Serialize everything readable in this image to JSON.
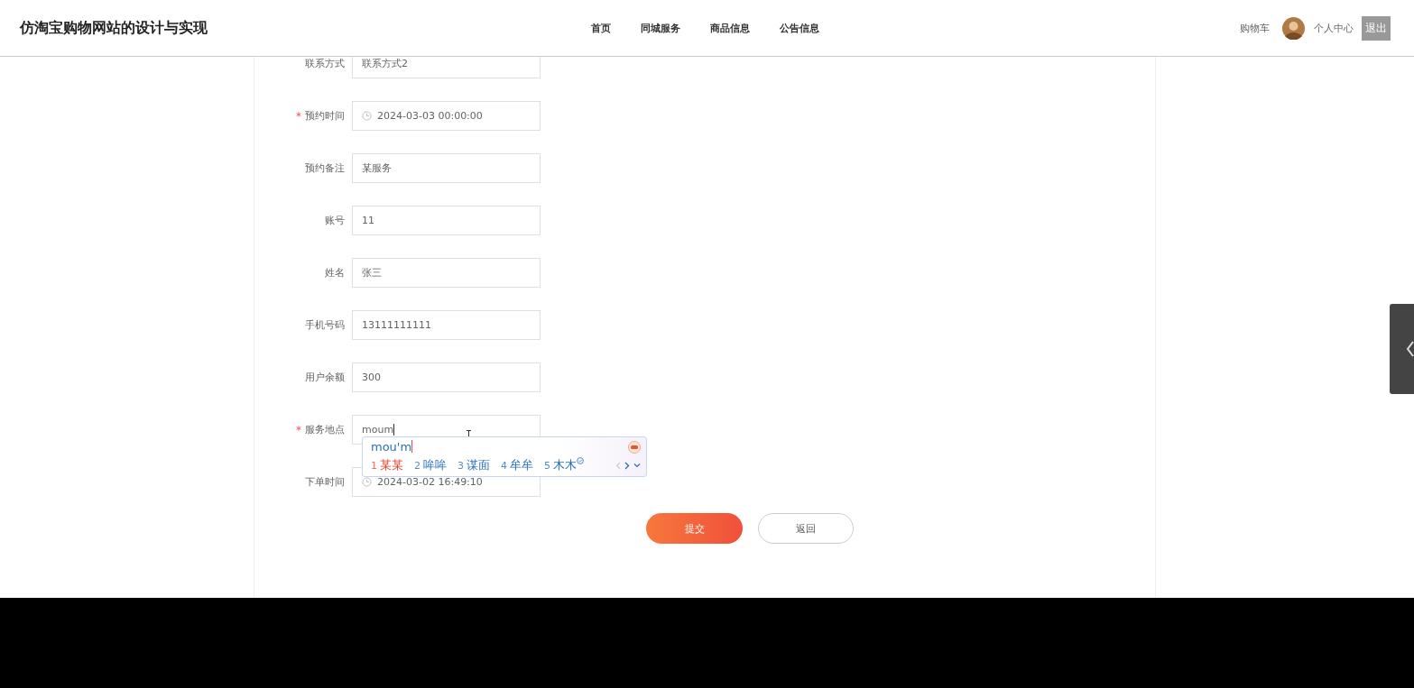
{
  "header": {
    "title": "仿淘宝购物网站的设计与实现",
    "nav": [
      {
        "label": "首页",
        "selected": false
      },
      {
        "label": "同城服务",
        "selected": false
      },
      {
        "label": "商品信息",
        "selected": false
      },
      {
        "label": "公告信息",
        "selected": false
      }
    ],
    "cart": "购物车",
    "user_center": "个人中心",
    "logout": "退出"
  },
  "form": {
    "fields": [
      {
        "label": "联系方式",
        "required": false,
        "kind": "text",
        "value": "联系方式2"
      },
      {
        "label": "预约时间",
        "required": true,
        "kind": "date",
        "value": "2024-03-03 00:00:00"
      },
      {
        "label": "预约备注",
        "required": false,
        "kind": "text",
        "value": "某服务"
      },
      {
        "label": "账号",
        "required": false,
        "kind": "text",
        "value": "11"
      },
      {
        "label": "姓名",
        "required": false,
        "kind": "text",
        "value": "张三"
      },
      {
        "label": "手机号码",
        "required": false,
        "kind": "text",
        "value": "13111111111"
      },
      {
        "label": "用户余额",
        "required": false,
        "kind": "text",
        "value": "300"
      },
      {
        "label": "服务地点",
        "required": true,
        "kind": "text",
        "value": "moum"
      },
      {
        "label": "下单时间",
        "required": false,
        "kind": "date",
        "value": "2024-03-02 16:49:10"
      }
    ],
    "buttons": [
      {
        "label": "提交",
        "kind": "primary"
      },
      {
        "label": "返回",
        "kind": "plain"
      }
    ]
  },
  "ime": {
    "composition": "mou'm",
    "candidates": [
      {
        "index": "1",
        "text": "某某",
        "selected": true
      },
      {
        "index": "2",
        "text": "哞哞",
        "selected": false
      },
      {
        "index": "3",
        "text": "谋面",
        "selected": false
      },
      {
        "index": "4",
        "text": "牟牟",
        "selected": false
      },
      {
        "index": "5",
        "text": "木木",
        "selected": false
      }
    ]
  }
}
